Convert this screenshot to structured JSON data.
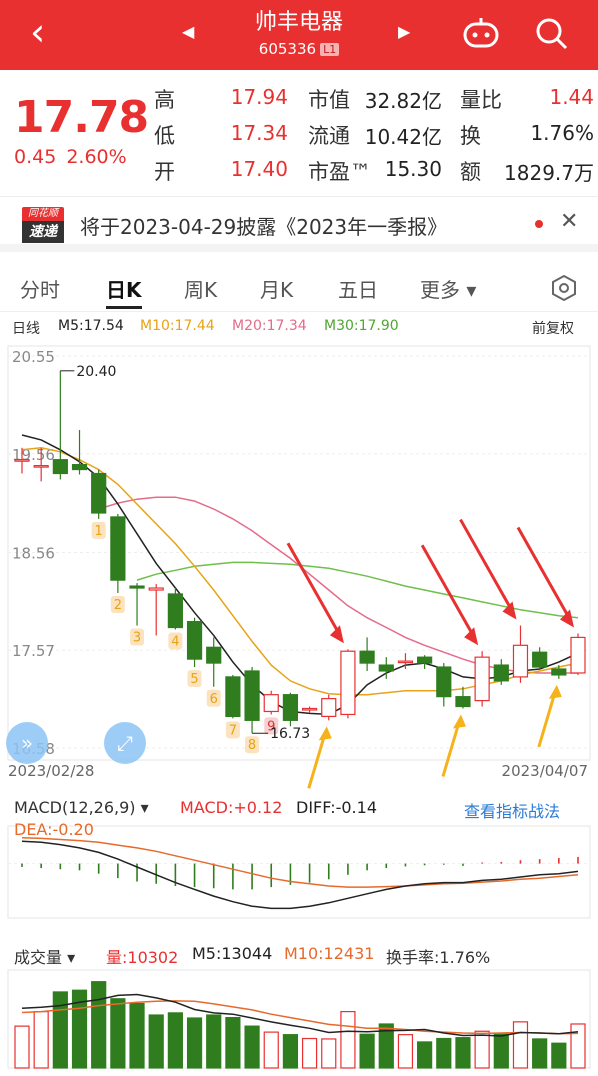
{
  "header": {
    "back_icon": "chevron-left-icon",
    "title": "帅丰电器",
    "code": "605336",
    "badge": "L1",
    "prev_icon": "triangle-left-icon",
    "next_icon": "triangle-right-icon",
    "robot_icon": "robot-icon",
    "search_icon": "search-icon",
    "bg_color": "#e93030"
  },
  "quote": {
    "price": "17.78",
    "change": "0.45",
    "change_pct": "2.60%",
    "labels": [
      "高",
      "低",
      "开"
    ],
    "values": [
      "17.94",
      "17.34",
      "17.40"
    ],
    "labels2": [
      "市值",
      "流通",
      "市盈™"
    ],
    "values2": [
      "32.82亿",
      "10.42亿",
      "15.30"
    ],
    "labels3": [
      "量比",
      "换",
      "额"
    ],
    "values3": [
      "1.44",
      "1.76%",
      "1829.7万"
    ]
  },
  "notice": {
    "logo_top": "同花顺",
    "logo_bottom": "速递",
    "text": "将于2023-04-29披露《2023年一季报》",
    "close_icon": "close-icon"
  },
  "tabs": [
    "分时",
    "日K",
    "周K",
    "月K",
    "五日",
    "更多 ▾"
  ],
  "active_tab": "日K",
  "settings_icon": "hexagon-settings-icon",
  "ma_legend": {
    "period": "日线",
    "ma5": "M5:17.54",
    "ma10": "M10:17.44",
    "ma20": "M20:17.34",
    "ma30": "M30:17.90",
    "adjust": "前复权"
  },
  "colors": {
    "up": "#e93030",
    "down": "#2f7d1e",
    "ma5": "#222222",
    "ma10": "#e8a316",
    "ma20": "#e46b8a",
    "ma30": "#6fbf4b",
    "arrow_red": "#e93030",
    "arrow_yellow": "#f5b21a"
  },
  "chart_data": {
    "type": "candlestick",
    "y_ticks": [
      "20.55",
      "19.56",
      "18.56",
      "17.57",
      "16.58"
    ],
    "ylim": [
      16.58,
      20.55
    ],
    "x_labels": [
      "2023/02/28",
      "2023/04/07"
    ],
    "max_label": "20.40",
    "min_label": "16.73",
    "candles": [
      {
        "o": 19.5,
        "c": 19.5,
        "h": 19.62,
        "l": 19.36
      },
      {
        "o": 19.44,
        "c": 19.44,
        "h": 19.62,
        "l": 19.28
      },
      {
        "o": 19.5,
        "c": 19.36,
        "h": 20.4,
        "l": 19.3
      },
      {
        "o": 19.45,
        "c": 19.4,
        "h": 19.8,
        "l": 19.35
      },
      {
        "o": 19.36,
        "c": 18.96,
        "h": 19.4,
        "l": 18.9
      },
      {
        "o": 18.92,
        "c": 18.28,
        "h": 18.95,
        "l": 18.15
      },
      {
        "o": 18.22,
        "c": 18.2,
        "h": 18.25,
        "l": 17.82
      },
      {
        "o": 18.18,
        "c": 18.2,
        "h": 18.24,
        "l": 17.72
      },
      {
        "o": 18.14,
        "c": 17.8,
        "h": 18.2,
        "l": 17.78
      },
      {
        "o": 17.86,
        "c": 17.48,
        "h": 17.9,
        "l": 17.4
      },
      {
        "o": 17.6,
        "c": 17.44,
        "h": 17.7,
        "l": 17.2
      },
      {
        "o": 17.3,
        "c": 16.9,
        "h": 17.32,
        "l": 16.88
      },
      {
        "o": 17.36,
        "c": 16.86,
        "h": 17.4,
        "l": 16.73
      },
      {
        "o": 16.95,
        "c": 17.12,
        "h": 17.16,
        "l": 16.92
      },
      {
        "o": 17.12,
        "c": 16.86,
        "h": 17.14,
        "l": 16.8
      },
      {
        "o": 16.98,
        "c": 16.98,
        "h": 17.0,
        "l": 16.94
      },
      {
        "o": 16.9,
        "c": 17.08,
        "h": 17.12,
        "l": 16.86
      },
      {
        "o": 16.92,
        "c": 17.56,
        "h": 17.58,
        "l": 16.88
      },
      {
        "o": 17.56,
        "c": 17.44,
        "h": 17.7,
        "l": 17.36
      },
      {
        "o": 17.42,
        "c": 17.36,
        "h": 17.5,
        "l": 17.28
      },
      {
        "o": 17.46,
        "c": 17.46,
        "h": 17.54,
        "l": 17.38
      },
      {
        "o": 17.5,
        "c": 17.44,
        "h": 17.52,
        "l": 17.38
      },
      {
        "o": 17.4,
        "c": 17.1,
        "h": 17.44,
        "l": 17.0
      },
      {
        "o": 17.1,
        "c": 17.0,
        "h": 17.2,
        "l": 16.98
      },
      {
        "o": 17.06,
        "c": 17.5,
        "h": 17.56,
        "l": 17.0
      },
      {
        "o": 17.42,
        "c": 17.26,
        "h": 17.48,
        "l": 17.22
      },
      {
        "o": 17.3,
        "c": 17.62,
        "h": 17.82,
        "l": 17.24
      },
      {
        "o": 17.55,
        "c": 17.4,
        "h": 17.6,
        "l": 17.38
      },
      {
        "o": 17.38,
        "c": 17.32,
        "h": 17.42,
        "l": 17.28
      },
      {
        "o": 17.34,
        "c": 17.7,
        "h": 17.74,
        "l": 17.32
      }
    ],
    "ma5": [
      19.75,
      19.7,
      19.6,
      19.48,
      19.32,
      19.05,
      18.75,
      18.45,
      18.2,
      17.95,
      17.72,
      17.45,
      17.22,
      17.05,
      16.95,
      16.93,
      16.92,
      17.02,
      17.22,
      17.34,
      17.42,
      17.44,
      17.38,
      17.3,
      17.28,
      17.3,
      17.36,
      17.38,
      17.45,
      17.54
    ],
    "ma10": [
      19.6,
      19.62,
      19.58,
      19.5,
      19.4,
      19.25,
      19.05,
      18.85,
      18.65,
      18.42,
      18.18,
      17.92,
      17.66,
      17.42,
      17.26,
      17.18,
      17.13,
      17.12,
      17.12,
      17.14,
      17.16,
      17.16,
      17.16,
      17.18,
      17.22,
      17.26,
      17.32,
      17.36,
      17.4,
      17.44
    ],
    "ma20": [
      null,
      null,
      null,
      null,
      19.0,
      19.06,
      19.1,
      19.12,
      19.12,
      19.08,
      19.0,
      18.9,
      18.78,
      18.64,
      18.5,
      18.34,
      18.18,
      18.02,
      17.9,
      17.8,
      17.7,
      17.62,
      17.55,
      17.48,
      17.42,
      17.38,
      17.35,
      17.34,
      17.34,
      17.34
    ],
    "ma30": [
      null,
      null,
      null,
      null,
      null,
      null,
      18.28,
      18.34,
      18.38,
      18.42,
      18.44,
      18.46,
      18.46,
      18.45,
      18.44,
      18.42,
      18.4,
      18.36,
      18.32,
      18.27,
      18.22,
      18.18,
      18.14,
      18.1,
      18.06,
      18.02,
      17.98,
      17.95,
      17.92,
      17.9
    ],
    "td_markers": [
      {
        "i": 4,
        "label": "1"
      },
      {
        "i": 5,
        "label": "2"
      },
      {
        "i": 6,
        "label": "3"
      },
      {
        "i": 8,
        "label": "4"
      },
      {
        "i": 9,
        "label": "5"
      },
      {
        "i": 10,
        "label": "6"
      },
      {
        "i": 11,
        "label": "7"
      },
      {
        "i": 12,
        "label": "8"
      },
      {
        "i": 13,
        "label": "9"
      }
    ],
    "red_arrows_at": [
      17,
      24,
      26,
      29
    ],
    "yellow_arrows_at": [
      16,
      23,
      28
    ],
    "macd": {
      "title": "MACD(12,26,9)",
      "macd_label": "MACD:+0.12",
      "diff_label": "DIFF:-0.14",
      "dea_label": "DEA:-0.20",
      "link": "查看指标战法",
      "hist": [
        -0.06,
        -0.08,
        -0.1,
        -0.12,
        -0.18,
        -0.26,
        -0.32,
        -0.36,
        -0.4,
        -0.42,
        -0.44,
        -0.46,
        -0.46,
        -0.42,
        -0.38,
        -0.34,
        -0.28,
        -0.2,
        -0.12,
        -0.08,
        -0.05,
        -0.03,
        -0.02,
        -0.04,
        0.02,
        0.03,
        0.06,
        0.08,
        0.1,
        0.12
      ],
      "diff": [
        0.4,
        0.38,
        0.34,
        0.28,
        0.2,
        0.08,
        -0.06,
        -0.2,
        -0.34,
        -0.46,
        -0.58,
        -0.68,
        -0.76,
        -0.8,
        -0.8,
        -0.76,
        -0.7,
        -0.62,
        -0.54,
        -0.46,
        -0.4,
        -0.36,
        -0.34,
        -0.34,
        -0.3,
        -0.28,
        -0.24,
        -0.2,
        -0.18,
        -0.14
      ],
      "dea": [
        0.46,
        0.45,
        0.43,
        0.41,
        0.38,
        0.33,
        0.28,
        0.22,
        0.14,
        0.06,
        -0.02,
        -0.1,
        -0.18,
        -0.26,
        -0.32,
        -0.36,
        -0.4,
        -0.42,
        -0.42,
        -0.41,
        -0.4,
        -0.38,
        -0.36,
        -0.35,
        -0.33,
        -0.31,
        -0.28,
        -0.26,
        -0.23,
        -0.2
      ],
      "ylim": [
        -0.9,
        0.6
      ]
    },
    "volume": {
      "title": "成交量 ▾",
      "vol_label": "量:10302",
      "m5_label": "M5:13044",
      "m10_label": "M10:12431",
      "turnover_label": "换手率:1.76%",
      "values": [
        9800,
        13200,
        17800,
        18200,
        20200,
        16200,
        15100,
        12400,
        12900,
        11700,
        12400,
        11800,
        9800,
        8400,
        7800,
        6900,
        6800,
        13200,
        7900,
        10300,
        7800,
        6100,
        6900,
        7100,
        8600,
        7900,
        10800,
        6800,
        5800,
        10302
      ],
      "up": [
        true,
        true,
        false,
        false,
        false,
        false,
        false,
        false,
        false,
        false,
        false,
        false,
        false,
        true,
        false,
        true,
        true,
        true,
        false,
        false,
        true,
        false,
        false,
        false,
        true,
        false,
        true,
        false,
        false,
        true
      ],
      "m5": [
        14000,
        14200,
        14600,
        15400,
        16000,
        17000,
        17200,
        16400,
        15400,
        13700,
        12900,
        12600,
        11700,
        10800,
        10000,
        9300,
        8300,
        8600,
        8500,
        8700,
        8800,
        9000,
        8200,
        7600,
        7700,
        7500,
        8300,
        8200,
        8000,
        8500
      ],
      "m10": [
        13000,
        13200,
        13600,
        14000,
        14600,
        15000,
        15400,
        15600,
        15700,
        15600,
        15000,
        14300,
        13600,
        12600,
        11800,
        11000,
        10200,
        9800,
        9300,
        9300,
        9000,
        8600,
        8400,
        8200,
        8100,
        8200,
        8300,
        8200,
        8000,
        8100
      ],
      "ylim": [
        0,
        22000
      ]
    }
  },
  "float_buttons": [
    "expand-arrows-icon",
    "fullscreen-icon"
  ]
}
